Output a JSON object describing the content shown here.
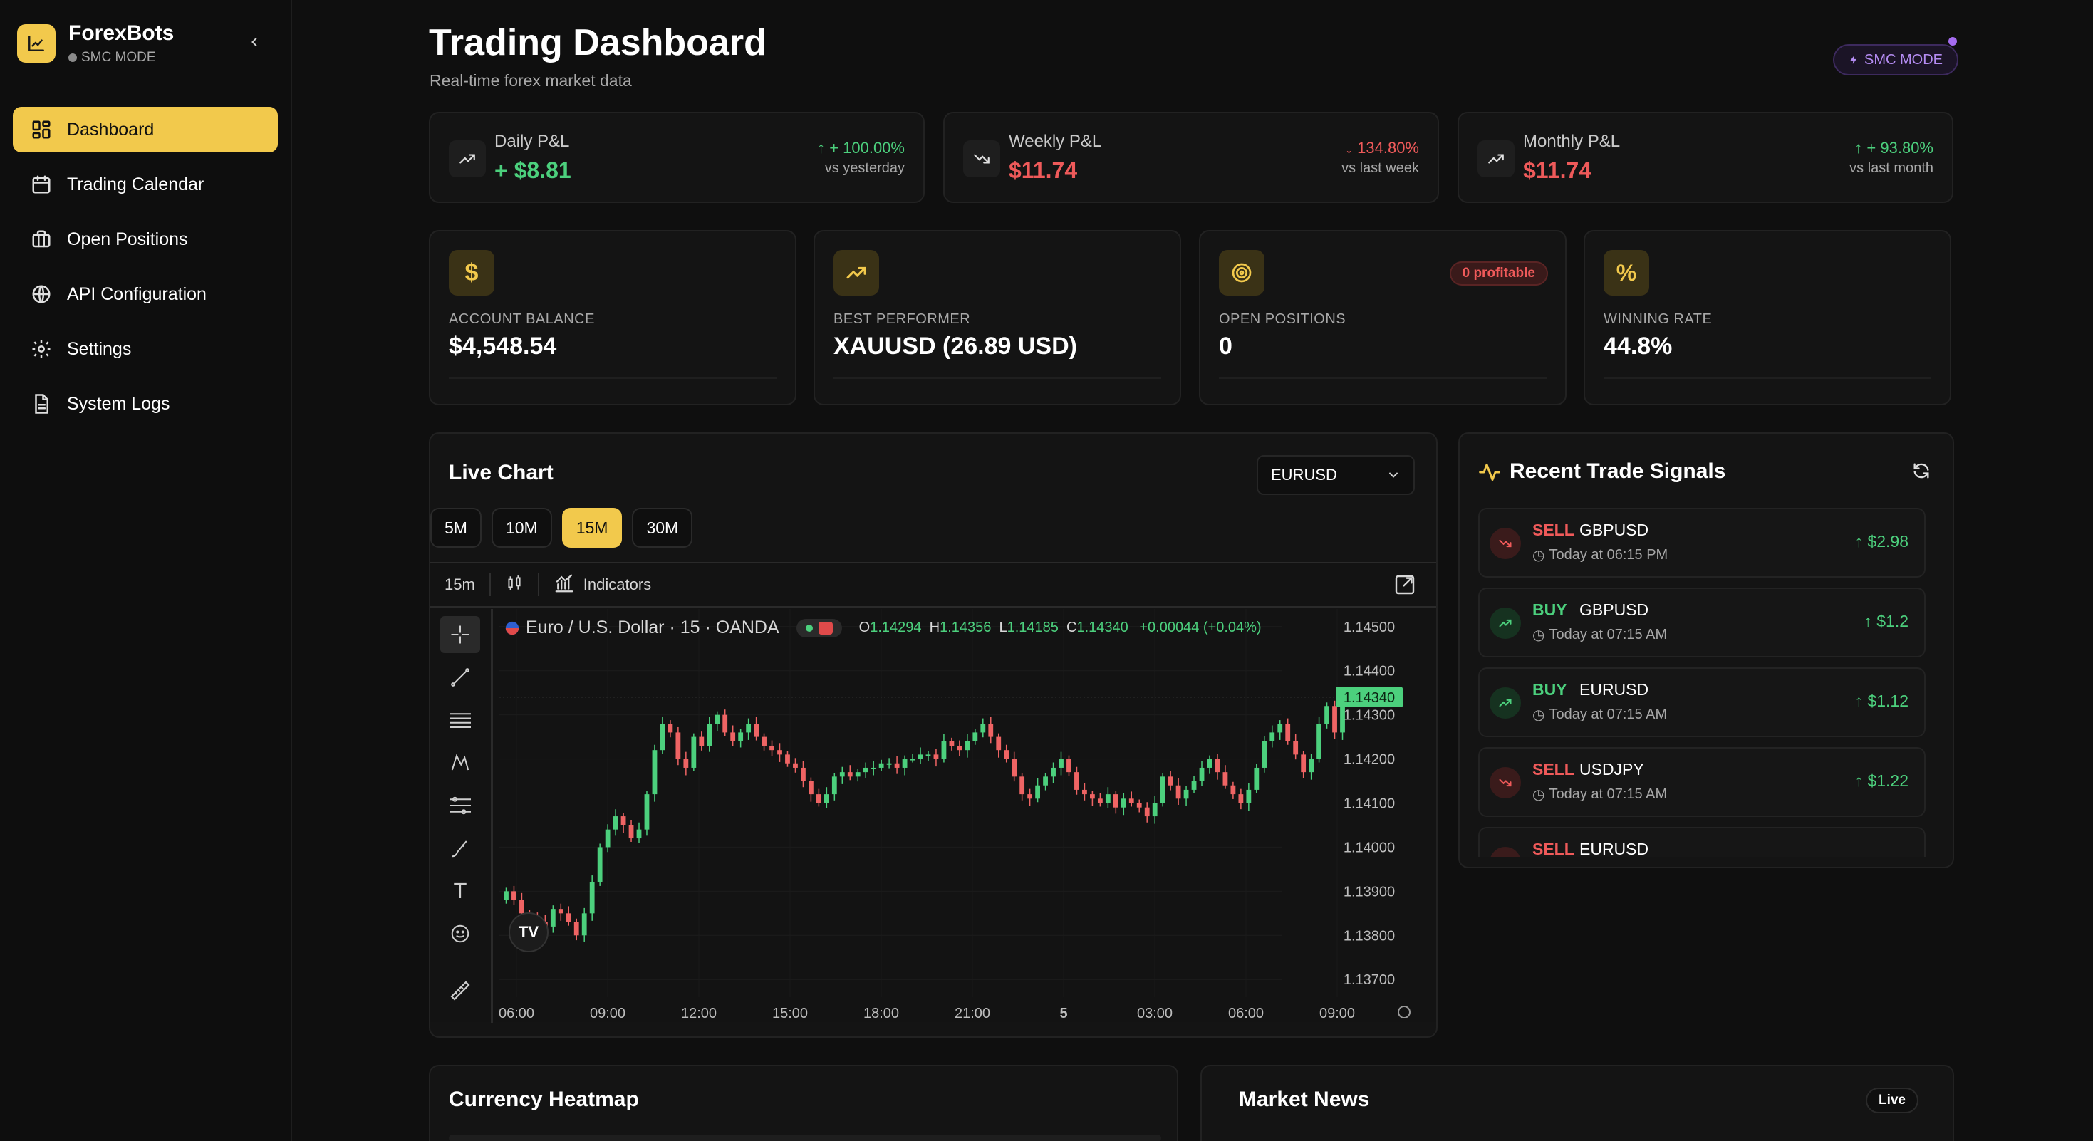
{
  "sidebar": {
    "brand_name": "ForexBots",
    "brand_mode": "SMC MODE",
    "items": [
      {
        "label": "Dashboard",
        "icon": "dashboard-icon",
        "active": true
      },
      {
        "label": "Trading Calendar",
        "icon": "calendar-icon"
      },
      {
        "label": "Open Positions",
        "icon": "briefcase-icon"
      },
      {
        "label": "API Configuration",
        "icon": "globe-icon"
      },
      {
        "label": "Settings",
        "icon": "gear-icon"
      },
      {
        "label": "System Logs",
        "icon": "document-icon"
      }
    ]
  },
  "header": {
    "title": "Trading Dashboard",
    "subtitle": "Real-time forex market data",
    "mode_badge": "SMC MODE"
  },
  "pnl": [
    {
      "label": "Daily P&L",
      "value": "+ $8.81",
      "change": "+ 100.00%",
      "compare": "vs yesterday",
      "direction": "up"
    },
    {
      "label": "Weekly P&L",
      "value": "$11.74",
      "change": "134.80%",
      "compare": "vs last week",
      "direction": "down"
    },
    {
      "label": "Monthly P&L",
      "value": "$11.74",
      "change": "+ 93.80%",
      "compare": "vs last month",
      "direction": "up"
    }
  ],
  "stats": [
    {
      "label": "ACCOUNT BALANCE",
      "value": "$4,548.54",
      "icon": "dollar-icon"
    },
    {
      "label": "BEST PERFORMER",
      "value": "XAUUSD (26.89 USD)",
      "icon": "trending-up-icon"
    },
    {
      "label": "OPEN POSITIONS",
      "value": "0",
      "icon": "target-icon",
      "badge": "0 profitable"
    },
    {
      "label": "WINNING RATE",
      "value": "44.8%",
      "icon": "percent-icon"
    }
  ],
  "live_chart": {
    "title": "Live Chart",
    "symbol": "EURUSD",
    "timeframes": [
      "5M",
      "10M",
      "15M",
      "30M"
    ],
    "active_timeframe": "15M",
    "toolbar": {
      "interval": "15m",
      "indicators": "Indicators"
    },
    "instrument": "Euro / U.S. Dollar · 15 · OANDA",
    "ohlc": {
      "o": "1.14294",
      "h": "1.14356",
      "l": "1.14185",
      "c": "1.14340",
      "change": "+0.00044 (+0.04%)"
    },
    "last_price": "1.14340",
    "logo": "TV"
  },
  "chart_data": {
    "type": "candlestick",
    "x_ticks": [
      "06:00",
      "09:00",
      "12:00",
      "15:00",
      "18:00",
      "21:00",
      "5",
      "03:00",
      "06:00",
      "09:00"
    ],
    "y_ticks": [
      "1.14500",
      "1.14400",
      "1.14300",
      "1.14200",
      "1.14100",
      "1.14000",
      "1.13900",
      "1.13800",
      "1.13700"
    ],
    "ylim": [
      1.1366,
      1.1454
    ],
    "closes": [
      1.139,
      1.1388,
      1.1385,
      1.1384,
      1.1383,
      1.1382,
      1.1386,
      1.1385,
      1.1383,
      1.138,
      1.1385,
      1.1392,
      1.14,
      1.1404,
      1.1407,
      1.1405,
      1.1402,
      1.1404,
      1.1412,
      1.1422,
      1.1428,
      1.1426,
      1.142,
      1.1418,
      1.1425,
      1.1423,
      1.1428,
      1.143,
      1.1426,
      1.1424,
      1.1426,
      1.1428,
      1.1425,
      1.1423,
      1.1422,
      1.1421,
      1.1419,
      1.1418,
      1.1415,
      1.1412,
      1.141,
      1.1412,
      1.1416,
      1.1417,
      1.1416,
      1.1417,
      1.1418,
      1.1418,
      1.1419,
      1.1419,
      1.1418,
      1.142,
      1.142,
      1.1421,
      1.1421,
      1.142,
      1.1424,
      1.1423,
      1.1422,
      1.1424,
      1.1426,
      1.1428,
      1.1425,
      1.1422,
      1.142,
      1.1416,
      1.1412,
      1.1411,
      1.1414,
      1.1416,
      1.1418,
      1.142,
      1.1417,
      1.1413,
      1.1412,
      1.1411,
      1.141,
      1.1412,
      1.1409,
      1.1411,
      1.141,
      1.1409,
      1.1407,
      1.141,
      1.1416,
      1.1414,
      1.1411,
      1.1413,
      1.1415,
      1.1418,
      1.142,
      1.1417,
      1.1414,
      1.1412,
      1.141,
      1.1413,
      1.1418,
      1.1424,
      1.1426,
      1.1428,
      1.1424,
      1.1421,
      1.1417,
      1.142,
      1.1428,
      1.1432,
      1.1426,
      1.1434
    ]
  },
  "signals": {
    "title": "Recent Trade Signals",
    "items": [
      {
        "side": "SELL",
        "pair": "GBPUSD",
        "time": "Today at 06:15 PM",
        "pnl": "$2.98"
      },
      {
        "side": "BUY",
        "pair": "GBPUSD",
        "time": "Today at 07:15 AM",
        "pnl": "$1.2"
      },
      {
        "side": "BUY",
        "pair": "EURUSD",
        "time": "Today at 07:15 AM",
        "pnl": "$1.12"
      },
      {
        "side": "SELL",
        "pair": "USDJPY",
        "time": "Today at 07:15 AM",
        "pnl": "$1.22"
      },
      {
        "side": "SELL",
        "pair": "EURUSD",
        "time": "",
        "pnl": ""
      }
    ]
  },
  "heatmap": {
    "title": "Currency Heatmap"
  },
  "news": {
    "title": "Market News",
    "badge": "Live"
  },
  "colors": {
    "accent": "#f2c94c",
    "up": "#4cd07d",
    "down": "#ef5a5a",
    "purple": "#b48cf2",
    "background": "#0f0f0f"
  }
}
